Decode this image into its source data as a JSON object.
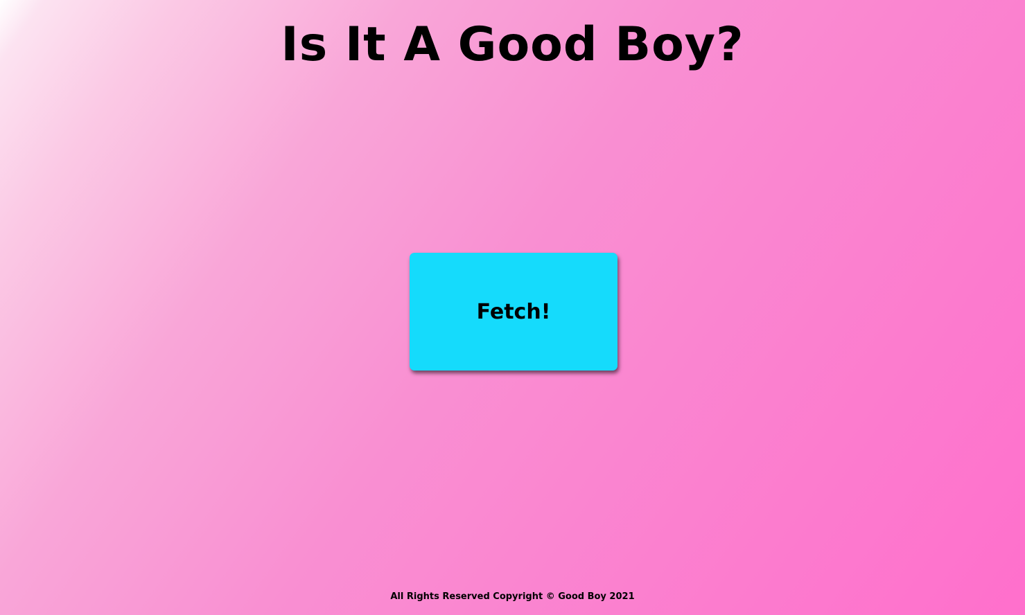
{
  "header": {
    "title": "Is It A Good Boy?"
  },
  "main": {
    "fetch_button_label": "Fetch!"
  },
  "footer": {
    "copyright": "All Rights Reserved Copyright © Good Boy 2021"
  },
  "colors": {
    "button_background": "#15dbfc",
    "background_start": "#ffffff",
    "background_end": "#ff6fcc",
    "text": "#000000"
  }
}
